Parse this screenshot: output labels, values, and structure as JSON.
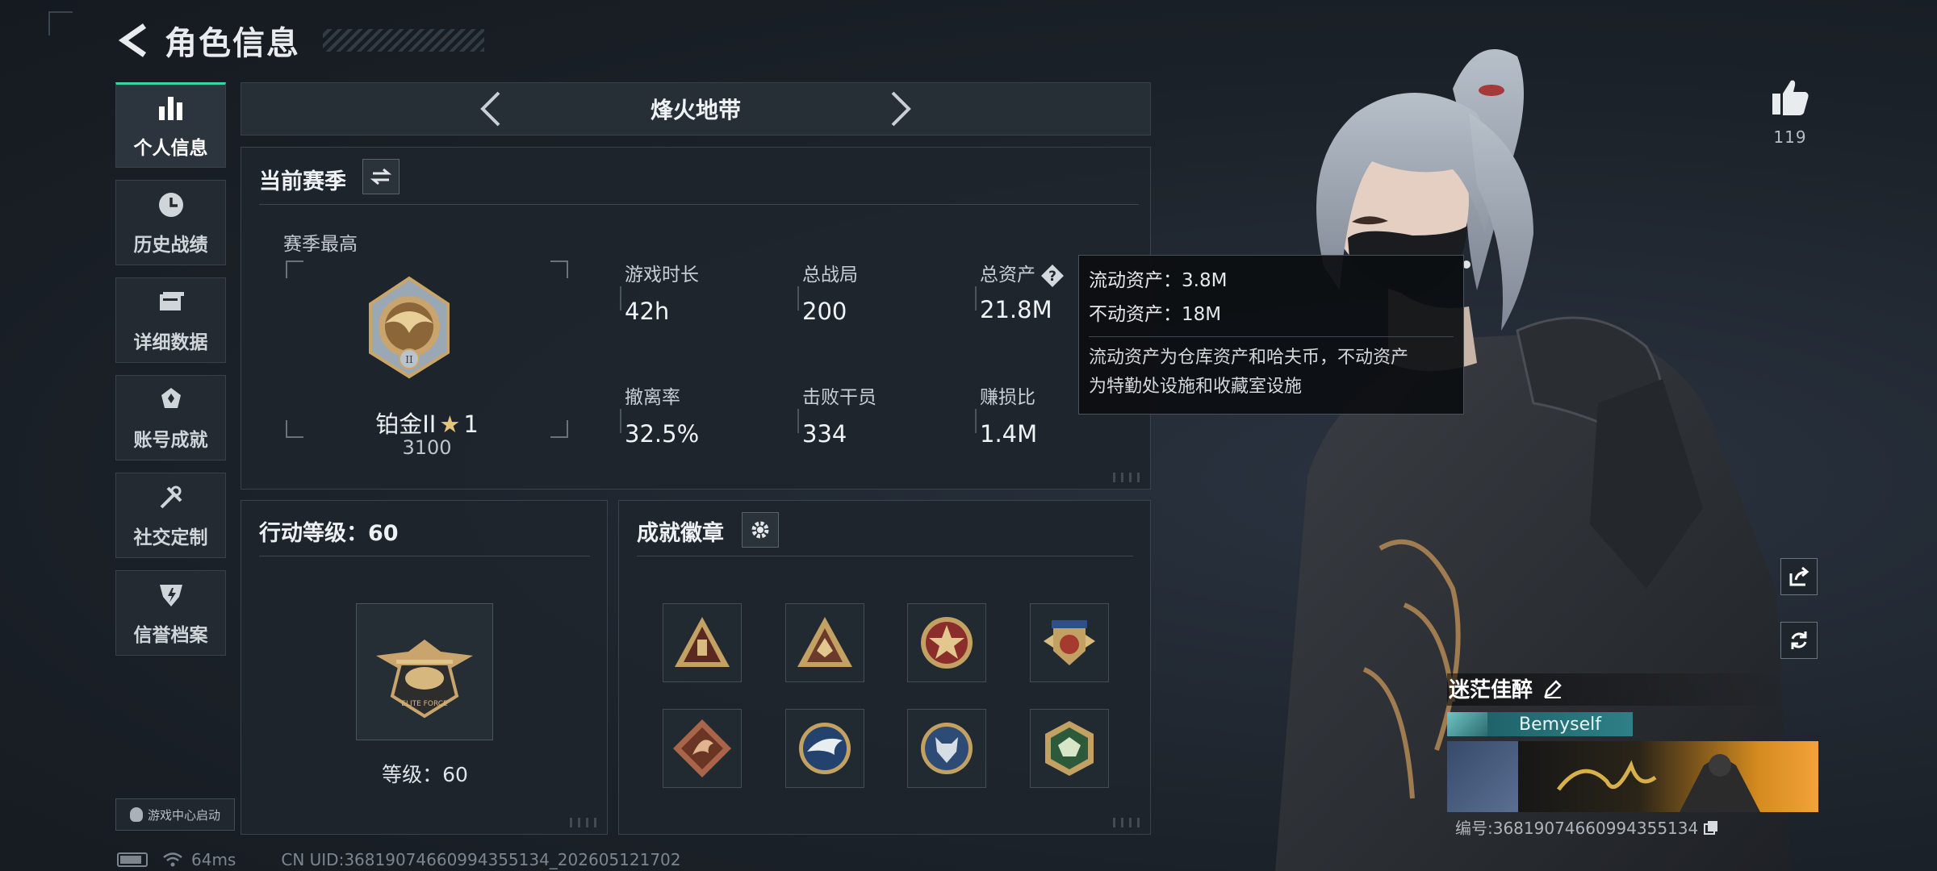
{
  "header": {
    "title": "角色信息"
  },
  "sidebar": {
    "items": [
      {
        "label": "个人信息",
        "icon": "bar-chart-icon",
        "active": true
      },
      {
        "label": "历史战绩",
        "icon": "clock-icon",
        "active": false
      },
      {
        "label": "详细数据",
        "icon": "folder-icon",
        "active": false
      },
      {
        "label": "账号成就",
        "icon": "trophy-icon",
        "active": false
      },
      {
        "label": "社交定制",
        "icon": "wrench-icon",
        "active": false
      },
      {
        "label": "信誉档案",
        "icon": "shield-icon",
        "active": false
      }
    ],
    "launch_label": "游戏中心启动"
  },
  "status_bar": {
    "ping": "64ms",
    "uid": "CN UID:36819074660994355134_202605121702"
  },
  "mode": {
    "title": "烽火地带"
  },
  "season": {
    "title": "当前赛季",
    "best_label": "赛季最高",
    "rank_name": "铂金II",
    "rank_stars": "1",
    "rank_score": "3100",
    "stats": [
      {
        "label": "游戏时长",
        "value": "42h"
      },
      {
        "label": "总战局",
        "value": "200"
      },
      {
        "label": "总资产",
        "value": "21.8M"
      },
      {
        "label": "撤离率",
        "value": "32.5%"
      },
      {
        "label": "击败干员",
        "value": "334"
      },
      {
        "label": "赚损比",
        "value": "1.4M"
      }
    ]
  },
  "tooltip": {
    "liquid": "流动资产：3.8M",
    "fixed": "不动资产：18M",
    "note_line1": "流动资产为仓库资产和哈夫币，不动资产",
    "note_line2": "为特勤处设施和收藏室设施"
  },
  "level": {
    "title": "行动等级：60",
    "label": "等级：60"
  },
  "medals": {
    "title": "成就徽章",
    "slots": [
      "triangle-medal",
      "triangle-medal-2",
      "star-medal",
      "wings-medal",
      "dragon-medal",
      "eagle-medal",
      "wolf-medal",
      "hex-medal"
    ]
  },
  "likes": {
    "count": "119"
  },
  "player": {
    "name": "迷茫佳醉",
    "tag": "Bemyself",
    "id_text": "编号:36819074660994355134"
  },
  "colors": {
    "accent": "#39d3a4",
    "gold": "#e2c77b",
    "panel": "#1e252c"
  }
}
